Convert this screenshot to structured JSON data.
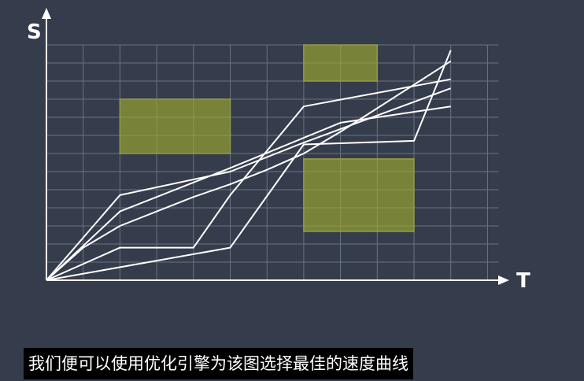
{
  "axes": {
    "y_label": "S",
    "x_label": "T"
  },
  "colors": {
    "background": "#353c4b",
    "grid": "#6b7384",
    "curve": "#ffffff",
    "obstacle_fill": "#7f8a37",
    "obstacle_stroke": "#9aa63f"
  },
  "grid": {
    "columns": 12,
    "rows": 13
  },
  "obstacles": [
    {
      "t0": 2,
      "t1": 5,
      "s0": 7,
      "s1": 10
    },
    {
      "t0": 7,
      "t1": 9,
      "s0": 11,
      "s1": 13
    },
    {
      "t0": 7,
      "t1": 10,
      "s0": 2.7,
      "s1": 6.7
    }
  ],
  "curves": [
    [
      [
        0,
        0
      ],
      [
        1,
        1.8
      ],
      [
        2,
        3
      ],
      [
        3,
        3.8
      ],
      [
        4,
        4.6
      ],
      [
        5,
        5.3
      ],
      [
        6,
        6.1
      ],
      [
        7,
        7
      ],
      [
        8,
        8.2
      ],
      [
        9,
        9.5
      ],
      [
        10,
        10.8
      ],
      [
        11,
        12.1
      ]
    ],
    [
      [
        0,
        0
      ],
      [
        2,
        4.7
      ],
      [
        5,
        6
      ],
      [
        7,
        7.6
      ],
      [
        11,
        10.6
      ]
    ],
    [
      [
        0,
        0
      ],
      [
        2,
        3.8
      ],
      [
        5,
        6.2
      ],
      [
        8,
        8.7
      ],
      [
        11,
        9.6
      ]
    ],
    [
      [
        0,
        0
      ],
      [
        2,
        1.8
      ],
      [
        4,
        1.8
      ],
      [
        5,
        4.7
      ],
      [
        7,
        9.6
      ],
      [
        11,
        11.1
      ]
    ],
    [
      [
        0,
        0
      ],
      [
        5,
        1.8
      ],
      [
        7,
        7.5
      ],
      [
        10,
        7.7
      ],
      [
        11,
        12.7
      ]
    ]
  ],
  "subtitle": "我们便可以使用优化引擎为该图选择最佳的速度曲线"
}
